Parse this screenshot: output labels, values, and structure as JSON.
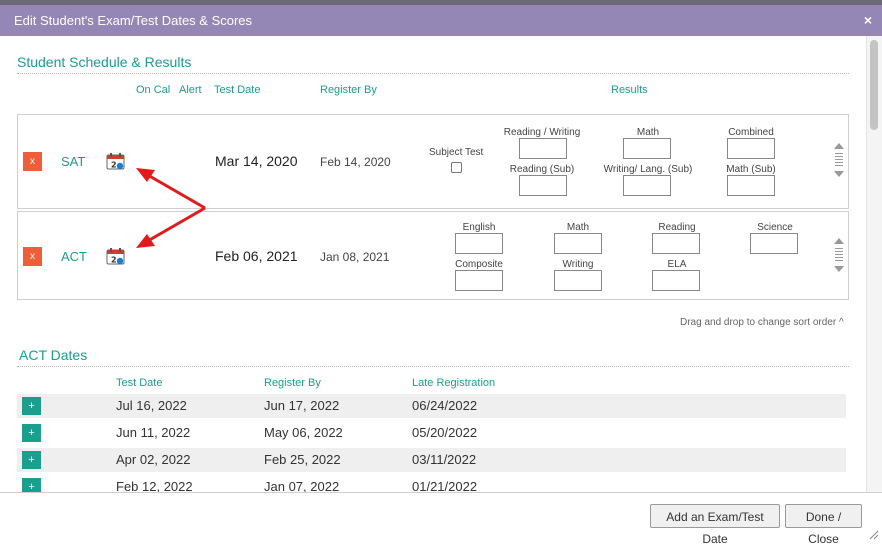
{
  "dialog": {
    "title": "Edit Student's Exam/Test Dates & Scores",
    "close_glyph": "×"
  },
  "schedule": {
    "title": "Student Schedule & Results",
    "headers": {
      "on_cal": "On Cal",
      "alert": "Alert",
      "test_date": "Test Date",
      "register_by": "Register By",
      "results": "Results"
    },
    "exams": [
      {
        "remove": "x",
        "name": "SAT",
        "date": "Mar 14, 2020",
        "register_by": "Feb 14, 2020",
        "subject_test_label": "Subject Test",
        "fields": [
          "Reading / Writing",
          "Math",
          "Combined",
          "Reading (Sub)",
          "Writing/ Lang. (Sub)",
          "Math (Sub)"
        ]
      },
      {
        "remove": "x",
        "name": "ACT",
        "date": "Feb 06, 2021",
        "register_by": "Jan 08, 2021",
        "fields": [
          "English",
          "Math",
          "Reading",
          "Science",
          "Composite",
          "Writing",
          "ELA"
        ]
      }
    ],
    "drag_hint": "Drag and drop to change sort order ^"
  },
  "act_dates": {
    "title": "ACT Dates",
    "headers": {
      "test_date": "Test Date",
      "register_by": "Register By",
      "late_registration": "Late Registration"
    },
    "rows": [
      {
        "add": "+",
        "test_date": "Jul 16, 2022",
        "register_by": "Jun 17, 2022",
        "late": "06/24/2022"
      },
      {
        "add": "+",
        "test_date": "Jun 11, 2022",
        "register_by": "May 06, 2022",
        "late": "05/20/2022"
      },
      {
        "add": "+",
        "test_date": "Apr 02, 2022",
        "register_by": "Feb 25, 2022",
        "late": "03/11/2022"
      },
      {
        "add": "+",
        "test_date": "Feb 12, 2022",
        "register_by": "Jan 07, 2022",
        "late": "01/21/2022"
      }
    ]
  },
  "footer": {
    "add_label": "Add an Exam/Test Date",
    "done_label": "Done / Close"
  },
  "colors": {
    "title_bar": "#9587b5",
    "accent": "#1a9e8e",
    "remove": "#ef5e3a",
    "arrow": "#e3191b"
  },
  "icons": {
    "calendar": "calendar-icon",
    "drag": "drag-handle-icon",
    "resize": "resize-grip-icon"
  }
}
